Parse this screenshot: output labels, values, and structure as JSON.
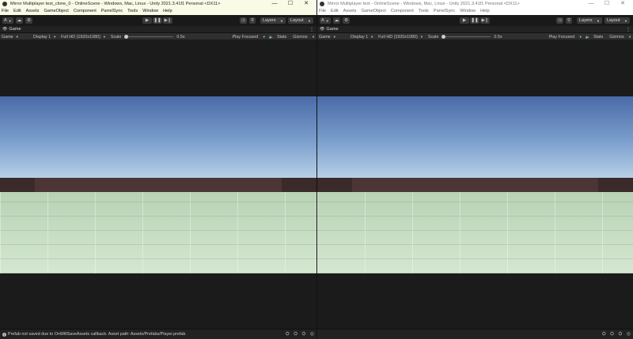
{
  "windows": [
    {
      "title": "Mirror Multiplayer test_clone_0 - OnlineScene - Windows, Mac, Linux - Unity 2021.3.41f1 Personal <DX11>",
      "menu": [
        "File",
        "Edit",
        "Assets",
        "GameObject",
        "Component",
        "ParrelSync",
        "Tools",
        "Window",
        "Help"
      ],
      "toolbar": {
        "account": "A",
        "layers": "Layers",
        "layout": "Layout"
      },
      "tab": {
        "label": "Game"
      },
      "gamebar": {
        "view": "Game",
        "display": "Display 1",
        "resolution": "Full HD (1920x1080)",
        "scale_label": "Scale",
        "scale_value": "0.5x",
        "play_mode": "Play Focused",
        "stats": "Stats",
        "gizmos": "Gizmos"
      },
      "status": {
        "message": "Prefab not saved due to OnWillSaveAssets callback. Asset path: Assets/Prefabs/Player.prefab"
      }
    },
    {
      "title": "Mirror Multiplayer test - OnlineScene - Windows, Mac, Linux - Unity 2021.3.41f1 Personal <DX11>",
      "menu": [
        "File",
        "Edit",
        "Assets",
        "GameObject",
        "Component",
        "Tools",
        "ParrelSync",
        "Window",
        "Help"
      ],
      "toolbar": {
        "account": "A",
        "layers": "Layers",
        "layout": "Layout"
      },
      "tab": {
        "label": "Game"
      },
      "gamebar": {
        "view": "Game",
        "display": "Display 1",
        "resolution": "Full HD (1920x1080)",
        "scale_label": "Scale",
        "scale_value": "0.5x",
        "play_mode": "Play Focused",
        "stats": "Stats",
        "gizmos": "Gizmos"
      },
      "status": {
        "message": ""
      }
    }
  ],
  "icons": {
    "window_controls": [
      "minimize-icon",
      "maximize-icon",
      "close-icon"
    ],
    "play_controls": [
      "play-icon",
      "pause-icon",
      "step-icon"
    ]
  },
  "glyphs": {
    "minimize": "—",
    "maximize": "☐",
    "close": "✕",
    "play": "▶",
    "pause": "❚❚",
    "step": "▶❙",
    "chevron": "▼",
    "cloud": "☁",
    "gear": "⚙",
    "history": "◷",
    "search": "⚲",
    "info": "i",
    "mute": "🔈",
    "kebab": "⋮",
    "game_tab": "👁"
  },
  "colors": {
    "sky_top": "#4a6aa8",
    "sky_horizon": "#b6d0e6",
    "wall": "#4c3535",
    "floor": "#c8ddc4",
    "editor_bg": "#282828"
  }
}
